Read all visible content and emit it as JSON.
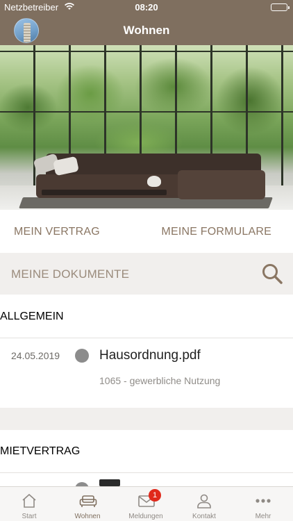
{
  "status_bar": {
    "carrier": "Netzbetreiber",
    "time": "08:20"
  },
  "header": {
    "title": "Wohnen"
  },
  "actions": {
    "left_label": "MEIN VERTRAG",
    "right_label": "MEINE FORMULARE"
  },
  "search": {
    "label": "MEINE DOKUMENTE"
  },
  "sections": [
    {
      "title": "ALLGEMEIN",
      "documents": [
        {
          "date": "24.05.2019",
          "name": "Hausordnung.pdf",
          "subtitle": "1065 - gewerbliche Nutzung"
        }
      ]
    },
    {
      "title": "MIETVERTRAG",
      "documents": []
    }
  ],
  "tabbar": {
    "items": [
      {
        "label": "Start",
        "icon": "home-icon"
      },
      {
        "label": "Wohnen",
        "icon": "sofa-icon",
        "active": true
      },
      {
        "label": "Meldungen",
        "icon": "mail-icon",
        "badge": "1"
      },
      {
        "label": "Kontakt",
        "icon": "person-icon"
      },
      {
        "label": "Mehr",
        "icon": "more-icon"
      }
    ]
  },
  "colors": {
    "brand": "#7f6f5f",
    "accent_text": "#8a7663",
    "badge": "#e0291b"
  }
}
